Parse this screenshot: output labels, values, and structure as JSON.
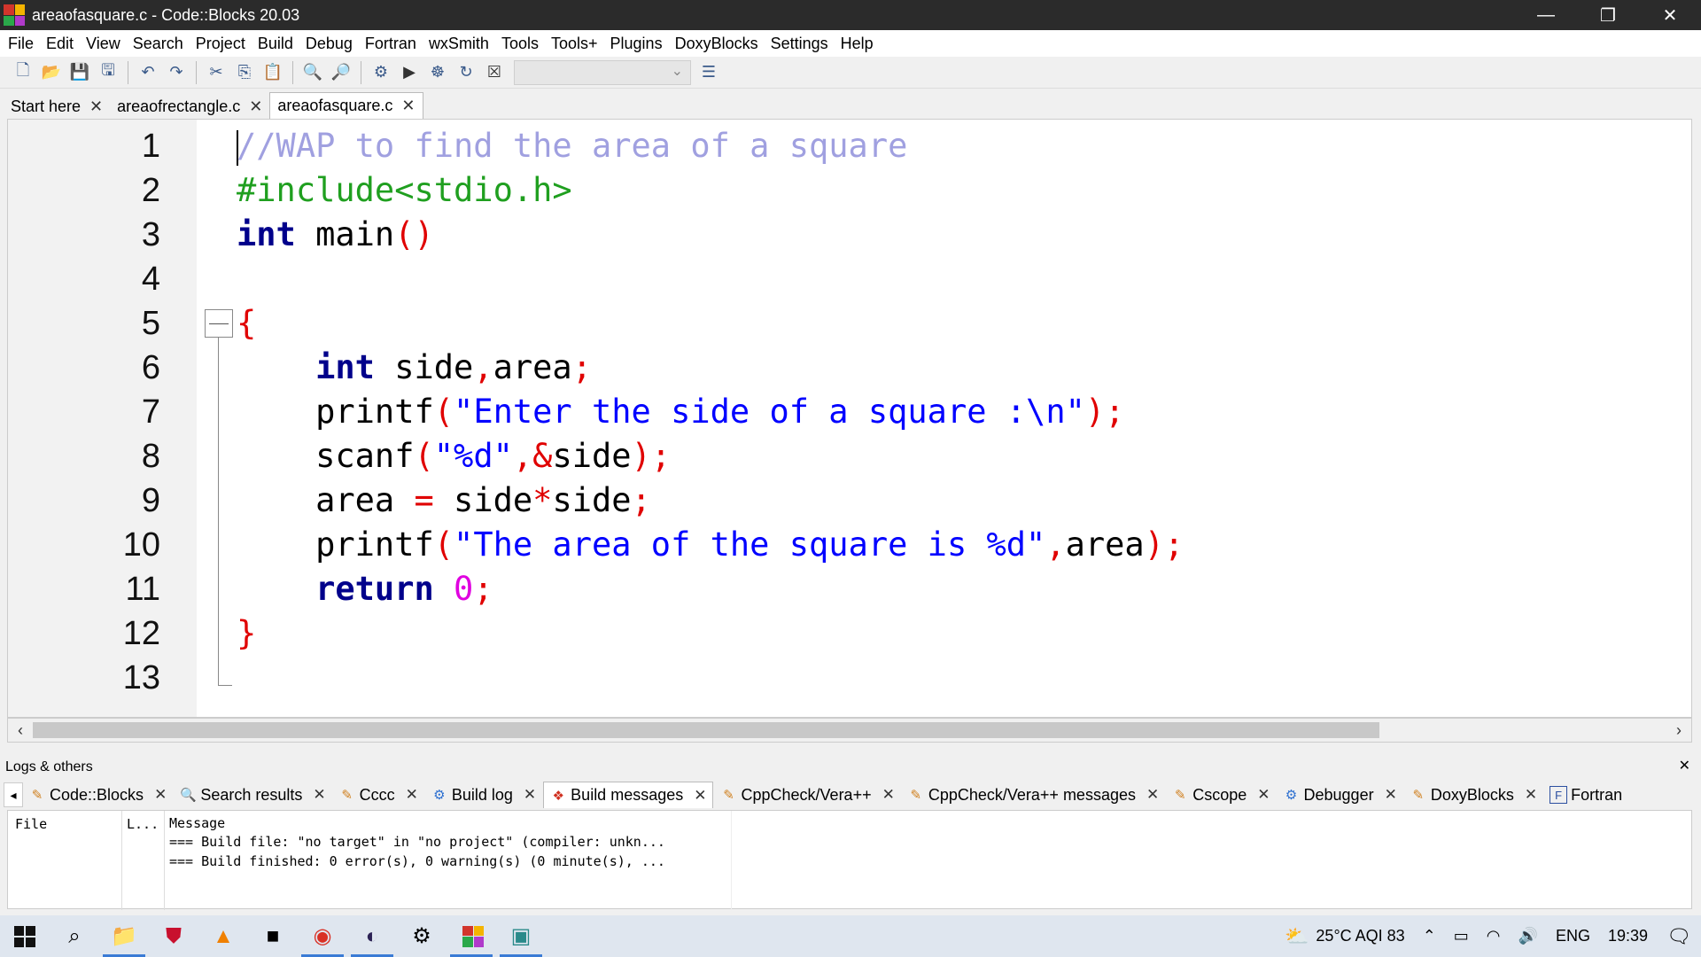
{
  "window": {
    "title": "areaofasquare.c - Code::Blocks 20.03"
  },
  "menu": [
    "File",
    "Edit",
    "View",
    "Search",
    "Project",
    "Build",
    "Debug",
    "Fortran",
    "wxSmith",
    "Tools",
    "Tools+",
    "Plugins",
    "DoxyBlocks",
    "Settings",
    "Help"
  ],
  "editor_tabs": [
    {
      "label": "Start here"
    },
    {
      "label": "areaofrectangle.c"
    },
    {
      "label": "areaofasquare.c",
      "active": true
    }
  ],
  "line_numbers": [
    "1",
    "2",
    "3",
    "4",
    "5",
    "6",
    "7",
    "8",
    "9",
    "10",
    "11",
    "12",
    "13"
  ],
  "code": {
    "l1": "//WAP to find the area of a square",
    "l2": "#include<stdio.h>",
    "l3_kw": "int",
    "l3_rest": " main",
    "l3_paren": "()",
    "l5": "{",
    "l6_kw": "int",
    "l6_rest": " side",
    "l6_comma": ",",
    "l6_rest2": "area",
    "l6_semi": ";",
    "l7_fn": "printf",
    "l7_op1": "(",
    "l7_str": "\"Enter the side of a square :\\n\"",
    "l7_op2": ");",
    "l8_fn": "scanf",
    "l8_op1": "(",
    "l8_str": "\"%d\"",
    "l8_op2": ",&",
    "l8_rest": "side",
    "l8_op3": ");",
    "l9_rest": "area ",
    "l9_op1": "=",
    "l9_rest2": " side",
    "l9_op2": "*",
    "l9_rest3": "side",
    "l9_op3": ";",
    "l10_fn": "printf",
    "l10_op1": "(",
    "l10_str": "\"The area of the square is %d\"",
    "l10_op2": ",",
    "l10_rest": "area",
    "l10_op3": ");",
    "l11_kw": "return",
    "l11_num": "0",
    "l11_op": ";",
    "l12": "}"
  },
  "logs": {
    "title": "Logs & others",
    "tabs": [
      {
        "label": "Code::Blocks",
        "icon": "pencil-icon"
      },
      {
        "label": "Search results",
        "icon": "search-icon"
      },
      {
        "label": "Cccc",
        "icon": "pencil-icon"
      },
      {
        "label": "Build log",
        "icon": "gear-icon"
      },
      {
        "label": "Build messages",
        "icon": "pin-icon",
        "active": true
      },
      {
        "label": "CppCheck/Vera++",
        "icon": "pencil-icon"
      },
      {
        "label": "CppCheck/Vera++ messages",
        "icon": "pencil-icon"
      },
      {
        "label": "Cscope",
        "icon": "pencil-icon"
      },
      {
        "label": "Debugger",
        "icon": "gear-icon"
      },
      {
        "label": "DoxyBlocks",
        "icon": "pencil-icon"
      },
      {
        "label": "Fortran",
        "icon": "fortran-icon"
      }
    ],
    "columns": {
      "file": "File",
      "line": "L...",
      "message": "Message"
    },
    "messages": [
      "=== Build file: \"no target\" in \"no project\" (compiler: unkn...",
      "=== Build finished: 0 error(s), 0 warning(s) (0 minute(s), ..."
    ]
  },
  "taskbar": {
    "weather": "25°C AQI 83",
    "language": "ENG",
    "time": "19:39"
  }
}
